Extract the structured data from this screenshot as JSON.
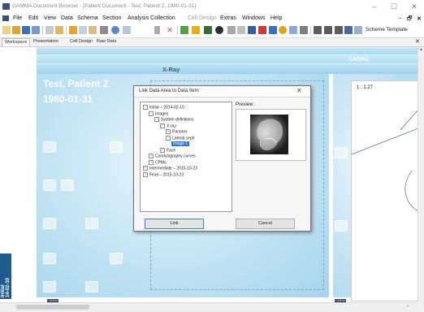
{
  "window": {
    "title": "GAMMA Document Browser - [Patient Document - Test, Patient 2, 1980-01-31]",
    "controls": {
      "minimize": "–",
      "maximize": "☐",
      "close": "✕"
    }
  },
  "menubar": {
    "items": [
      "File",
      "Edit",
      "View",
      "Data",
      "Schema",
      "Section",
      "Analysis Collection",
      "Cell Design",
      "Extras",
      "Windows",
      "Help"
    ],
    "disabled": [
      "Cell Design"
    ],
    "right_controls": {
      "minimize": "–",
      "restore": "🗗",
      "close": "✕"
    }
  },
  "toolbar": {
    "schema_template_label": "Scheme Template"
  },
  "tabs": {
    "items": [
      "Workspace",
      "Presentation",
      "Cell Design",
      "Raw Data"
    ],
    "active": "Workspace",
    "close": "✕"
  },
  "document": {
    "section_header": "CADIAS",
    "view_title": "X-Ray",
    "patient_name": "Test, Patient 2",
    "patient_birthdate": "1980-01-31",
    "ruler_label": "1 : 1.27",
    "side_label_left": "Initial\n14-02-10",
    "gamma_logo": "GAMMA\nDENTAL"
  },
  "dialog": {
    "title": "Link Data Area to Data Item",
    "close_icon": "✕",
    "preview_label": "Preview:",
    "tree": [
      {
        "label": "Initial – 2014-02-10",
        "level": 0,
        "toggle": "−"
      },
      {
        "label": "Images",
        "level": 1,
        "toggle": "−"
      },
      {
        "label": "System definitions",
        "level": 2,
        "toggle": "−"
      },
      {
        "label": "X-ray",
        "level": 3,
        "toggle": "−"
      },
      {
        "label": "Panorex",
        "level": 4,
        "toggle": "+"
      },
      {
        "label": "Lateral ceph",
        "level": 4,
        "toggle": "−"
      },
      {
        "label": "Image 1",
        "level": 5,
        "toggle": "",
        "selected": true
      },
      {
        "label": "Face",
        "level": 3,
        "toggle": "+"
      },
      {
        "label": "Condylography curves",
        "level": 1,
        "toggle": "+"
      },
      {
        "label": "CPMs",
        "level": 1,
        "toggle": "+"
      },
      {
        "label": "Intermediate – 2015-10-23",
        "level": 0,
        "toggle": "+"
      },
      {
        "label": "Final – 2015-10-23",
        "level": 0,
        "toggle": "+"
      }
    ],
    "link_button": "Link",
    "cancel_button": "Cancel"
  },
  "colors": {
    "accent": "#2f76d2",
    "sheet_light": "#e9f6fc",
    "sheet_dark": "#a8d4ec",
    "document_text": "#ffffff"
  }
}
